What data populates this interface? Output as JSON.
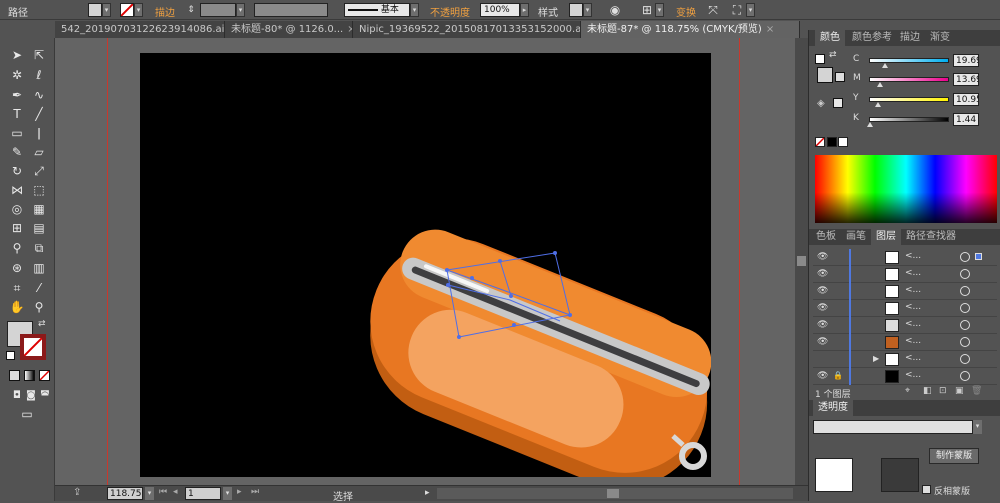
{
  "control_bar": {
    "object_type": "路径",
    "stroke_label": "描边",
    "stroke_profile": "基本",
    "opacity_label": "不透明度",
    "opacity_value": "100%",
    "style_label": "样式",
    "transform_label": "变换"
  },
  "document_tabs": [
    {
      "label": "542_20190703122623914086.ai*",
      "active": false
    },
    {
      "label": "未标题-80* @ 1126.0...",
      "active": false
    },
    {
      "label": "Nipic_19369522_20150817013353152000.ai*",
      "active": false
    },
    {
      "label": "未标题-87* @ 118.75% (CMYK/预览)",
      "active": true
    }
  ],
  "tab_close_glyph": "×",
  "status_bar": {
    "zoom": "118.75",
    "artboard_number": "1",
    "tool_status": "选择"
  },
  "color_panel": {
    "tabs": [
      "颜色",
      "颜色参考",
      "描边",
      "渐变"
    ],
    "active_tab": "颜色",
    "channels": [
      {
        "label": "C",
        "value": "19.69",
        "track_colors": [
          "#ffffff",
          "#00aeef"
        ],
        "level": 0.197
      },
      {
        "label": "M",
        "value": "13.69",
        "track_colors": [
          "#ffffff",
          "#ec008c"
        ],
        "level": 0.137
      },
      {
        "label": "Y",
        "value": "10.95",
        "track_colors": [
          "#ffffff",
          "#fff200"
        ],
        "level": 0.11
      },
      {
        "label": "K",
        "value": "1.44",
        "track_colors": [
          "#ffffff",
          "#000000"
        ],
        "level": 0.014
      }
    ]
  },
  "layers_panel": {
    "tabs": [
      "色板",
      "画笔",
      "图层",
      "路径查找器"
    ],
    "active_tab": "图层",
    "rows": [
      {
        "name": "<...",
        "visible": true
      },
      {
        "name": "<...",
        "visible": true
      },
      {
        "name": "<...",
        "visible": true
      },
      {
        "name": "<...",
        "visible": true
      },
      {
        "name": "<...",
        "visible": true
      },
      {
        "name": "<...",
        "visible": true
      },
      {
        "name": "<...",
        "visible": false
      },
      {
        "name": "<...",
        "visible": true
      }
    ],
    "footer": "1 个图层"
  },
  "transparency_panel": {
    "title": "透明度",
    "make_mask_button": "制作蒙版",
    "invert_mask_label": "反相蒙版"
  },
  "colors": {
    "orange_body": "#e87722",
    "orange_light": "#f4a360",
    "selection": "#4f6ee6",
    "guide": "#c8392e"
  }
}
